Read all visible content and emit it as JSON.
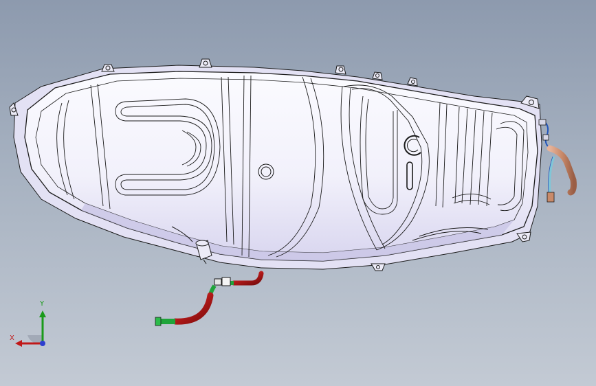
{
  "viewport": {
    "background_top": "#8d9aae",
    "background_bottom": "#c3cad4"
  },
  "model": {
    "part": "fuel tank",
    "body_color": "#f4f4fb",
    "shade_color": "#c9c6e6",
    "edge_color": "#1a1a1a",
    "hose_red": "#b01818",
    "hose_green": "#1fa43a",
    "hose_copper": "#c98a6a",
    "hose_cyan": "#7fc7d8",
    "hose_blue": "#2255bb"
  },
  "triad": {
    "y_label": "Y",
    "x_label": "X",
    "y_color": "#1a9a1a",
    "x_color": "#c01818",
    "z_color": "#2d3fcf"
  }
}
